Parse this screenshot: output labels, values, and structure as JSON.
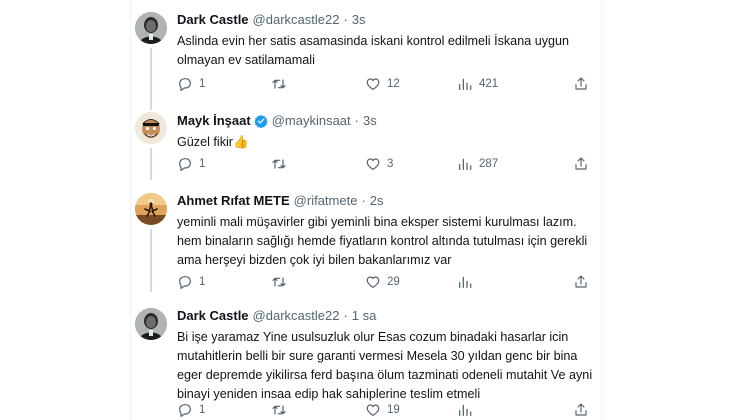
{
  "tweets": [
    {
      "name": "Dark Castle",
      "handle": "@darkcastle22",
      "time": "3s",
      "text": "Aslinda evin her satis asamasinda iskani kontrol edilmeli İskana uygun olmayan ev satilamamali",
      "replies": "1",
      "retweets": "",
      "likes": "12",
      "views": "421",
      "avatar": "dark-castle-portrait"
    },
    {
      "name": "Mayk İnşaat",
      "handle": "@maykinsaat",
      "time": "3s",
      "text": "Güzel fikir👍",
      "replies": "1",
      "retweets": "",
      "likes": "3",
      "views": "287",
      "verified": true,
      "avatar": "mayk-insaat-cartoon"
    },
    {
      "name": "Ahmet Rıfat METE",
      "handle": "@rifatmete",
      "time": "2s",
      "text": "yeminli mali müşavirler gibi yeminli bina eksper sistemi kurulması lazım. hem binaların sağlığı hemde fiyatların kontrol altında tutulması için gerekli ama herşeyi bizden çok iyi bilen bakanlarımız var",
      "replies": "1",
      "retweets": "",
      "likes": "29",
      "views": "",
      "avatar": "sunset-jump"
    },
    {
      "name": "Dark Castle",
      "handle": "@darkcastle22",
      "time": "1 sa",
      "text": "Bi işe yaramaz Yine usulsuzluk olur Esas cozum binadaki hasarlar icin mutahitlerin belli bir sure garanti vermesi Mesela 30 yıldan genc bir bina eger depremde yikilirsa ferd başına ölum tazminati odeneli mutahit Ve ayni binayi yeniden insaa edip hak sahiplerine teslim etmeli",
      "replies": "1",
      "retweets": "",
      "likes": "19",
      "views": "",
      "avatar": "dark-castle-portrait"
    }
  ],
  "colors": {
    "text": "#0f1419",
    "secondary": "#536471",
    "verified": "#1d9bf0",
    "divider": "#eff3f4"
  },
  "icons": [
    "reply-icon",
    "retweet-icon",
    "like-icon",
    "views-icon",
    "share-icon",
    "verified-badge-icon"
  ]
}
